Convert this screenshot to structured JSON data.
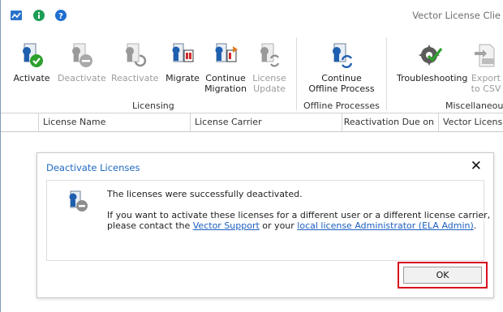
{
  "window": {
    "title": "Vector License Clie"
  },
  "ribbon": {
    "buttons": [
      {
        "label": "Activate",
        "line2": ""
      },
      {
        "label": "Deactivate",
        "line2": ""
      },
      {
        "label": "Reactivate",
        "line2": ""
      },
      {
        "label": "Migrate",
        "line2": ""
      },
      {
        "label": "Continue",
        "line2": "Migration"
      },
      {
        "label": "License",
        "line2": "Update"
      },
      {
        "label": "Continue",
        "line2": "Offline Process"
      },
      {
        "label": "Troubleshooting",
        "line2": ""
      },
      {
        "label": "Export",
        "line2": "to CSV"
      }
    ],
    "groups": [
      "Licensing",
      "Offline Processes",
      "Miscellaneous"
    ]
  },
  "grid": {
    "columns": [
      "License Name",
      "License Carrier",
      "Reactivation Due on",
      "Vector License"
    ]
  },
  "dialog": {
    "title": "Deactivate Licenses",
    "close": "✕",
    "message": "The licenses were successfully deactivated.",
    "line2": "If you want to activate these licenses for a different user or a different license carrier,",
    "line3_pre": "please contact the ",
    "link1": "Vector Support",
    "line3_mid": " or your ",
    "link2": "local license Administrator (ELA Admin)",
    "line3_post": ".",
    "ok": "OK"
  },
  "colors": {
    "accent_blue": "#2169c4",
    "link_blue": "#1b5fbf",
    "highlight_red": "#d80f1d",
    "success_green": "#2ca02c"
  }
}
